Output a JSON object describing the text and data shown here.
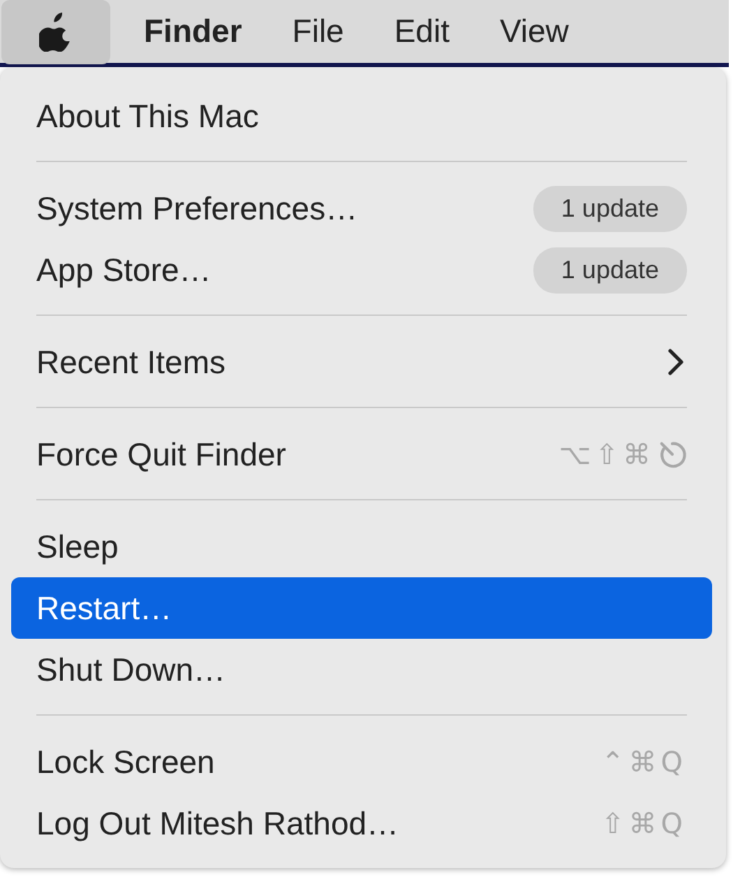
{
  "menu_bar": {
    "items": [
      {
        "kind": "apple",
        "selected": true
      },
      {
        "kind": "text",
        "label": "Finder",
        "bold": true,
        "selected": false
      },
      {
        "kind": "text",
        "label": "File",
        "bold": false,
        "selected": false
      },
      {
        "kind": "text",
        "label": "Edit",
        "bold": false,
        "selected": false
      },
      {
        "kind": "text",
        "label": "View",
        "bold": false,
        "selected": false
      }
    ]
  },
  "menu": {
    "items": [
      {
        "kind": "item",
        "label": "About This Mac",
        "selected": false
      },
      {
        "kind": "separator"
      },
      {
        "kind": "item",
        "label": "System Preferences…",
        "badge": "1 update",
        "selected": false
      },
      {
        "kind": "item",
        "label": "App Store…",
        "badge": "1 update",
        "selected": false
      },
      {
        "kind": "separator"
      },
      {
        "kind": "item",
        "label": "Recent Items",
        "submenu": true,
        "selected": false
      },
      {
        "kind": "separator"
      },
      {
        "kind": "item",
        "label": "Force Quit Finder",
        "shortcut": "⌥⇧⌘",
        "shortcut_end_icon": true,
        "selected": false
      },
      {
        "kind": "separator"
      },
      {
        "kind": "item",
        "label": "Sleep",
        "selected": false
      },
      {
        "kind": "item",
        "label": "Restart…",
        "selected": true
      },
      {
        "kind": "item",
        "label": "Shut Down…",
        "selected": false
      },
      {
        "kind": "separator"
      },
      {
        "kind": "item",
        "label": "Lock Screen",
        "shortcut": "⌃⌘Q",
        "selected": false
      },
      {
        "kind": "item",
        "label": "Log Out Mitesh Rathod…",
        "shortcut": "⇧⌘Q",
        "selected": false
      }
    ]
  }
}
